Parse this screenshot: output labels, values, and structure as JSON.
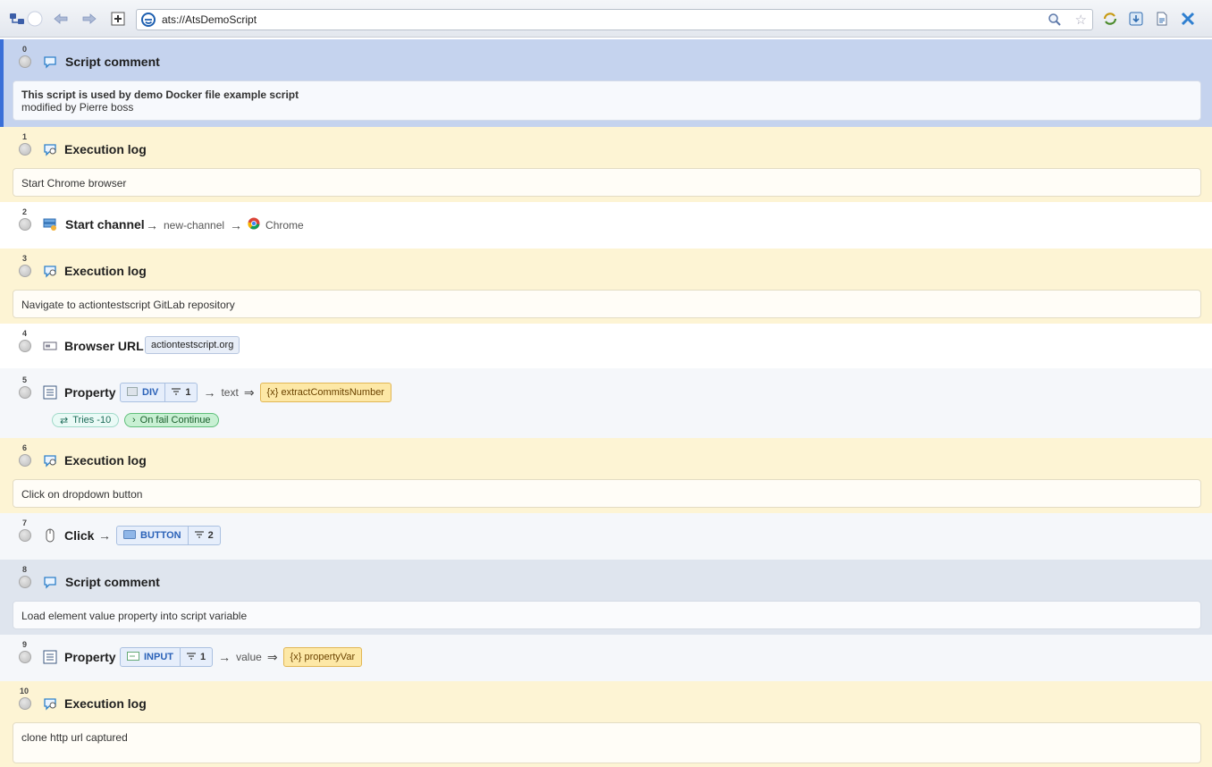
{
  "browser": {
    "address": "ats://AtsDemoScript"
  },
  "actions": [
    {
      "index": "0",
      "title": "Script comment",
      "text_bold": "This script is used by demo Docker file example script",
      "text": "modified by Pierre boss"
    },
    {
      "index": "1",
      "title": "Execution log",
      "text": "Start Chrome browser"
    },
    {
      "index": "2",
      "title": "Start channel",
      "channel_name": "new-channel",
      "browser": "Chrome"
    },
    {
      "index": "3",
      "title": "Execution log",
      "text": "Navigate to actiontestscript GitLab repository"
    },
    {
      "index": "4",
      "title": "Browser URL",
      "url": "actiontestscript.org"
    },
    {
      "index": "5",
      "title": "Property",
      "element": "DIV",
      "criteria_count": "1",
      "property": "text",
      "variable": "{x} extractCommitsNumber",
      "tries": "Tries -10",
      "on_fail": "On fail Continue"
    },
    {
      "index": "6",
      "title": "Execution log",
      "text": "Click on dropdown button"
    },
    {
      "index": "7",
      "title": "Click",
      "element": "BUTTON",
      "criteria_count": "2"
    },
    {
      "index": "8",
      "title": "Script comment",
      "text": "Load element value property into script variable"
    },
    {
      "index": "9",
      "title": "Property",
      "element": "INPUT",
      "criteria_count": "1",
      "property": "value",
      "variable": "{x} propertyVar"
    },
    {
      "index": "10",
      "title": "Execution log",
      "text": "clone http url captured"
    }
  ],
  "colors": {
    "log_row": "#fdf4d4",
    "comment_row_selected": "#c5d3ee",
    "comment_row": "#dfe5ee",
    "selection_bar": "#3a6fd8",
    "variable_tag": "#fde8a6",
    "element_tag": "#e6eefb"
  }
}
